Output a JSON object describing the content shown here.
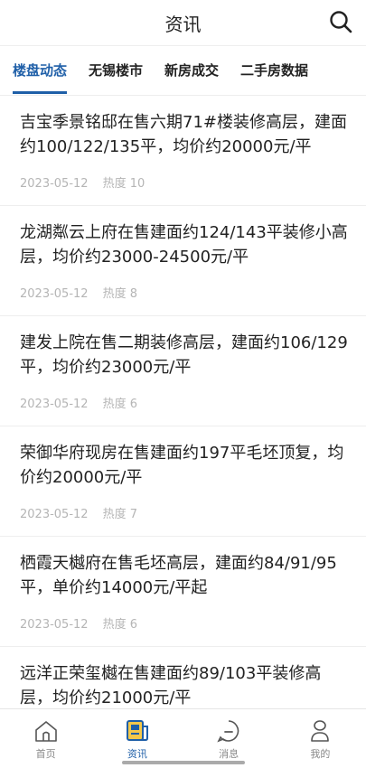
{
  "header": {
    "title": "资讯"
  },
  "tabs": [
    {
      "label": "楼盘动态"
    },
    {
      "label": "无锡楼市"
    },
    {
      "label": "新房成交"
    },
    {
      "label": "二手房数据"
    }
  ],
  "articles": [
    {
      "title": "吉宝季景铭邸在售六期71#楼装修高层，建面约100/122/135平，均价约20000元/平",
      "date": "2023-05-12",
      "heat": "热度 10"
    },
    {
      "title": "龙湖粼云上府在售建面约124/143平装修小高层，均价约23000-24500元/平",
      "date": "2023-05-12",
      "heat": "热度 8"
    },
    {
      "title": "建发上院在售二期装修高层，建面约106/129平，均价约23000元/平",
      "date": "2023-05-12",
      "heat": "热度 6"
    },
    {
      "title": "荣御华府现房在售建面约197平毛坯顶复，均价约20000元/平",
      "date": "2023-05-12",
      "heat": "热度 7"
    },
    {
      "title": "栖霞天樾府在售毛坯高层，建面约84/91/95平，单价约14000元/平起",
      "date": "2023-05-12",
      "heat": "热度 6"
    },
    {
      "title": "远洋正荣玺樾在售建面约89/103平装修高层，均价约21000元/平",
      "date": "",
      "heat": ""
    }
  ],
  "nav": [
    {
      "label": "首页",
      "icon": "home-icon"
    },
    {
      "label": "资讯",
      "icon": "news-icon"
    },
    {
      "label": "消息",
      "icon": "message-icon"
    },
    {
      "label": "我的",
      "icon": "profile-icon"
    }
  ],
  "colors": {
    "accent": "#1f5fa8"
  }
}
